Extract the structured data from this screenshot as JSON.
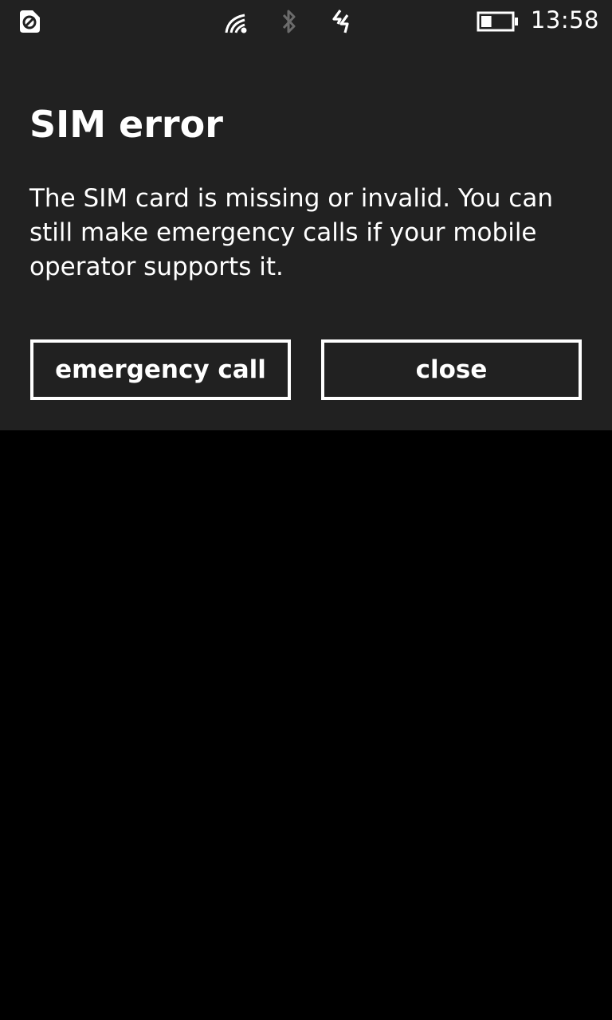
{
  "status_bar": {
    "time": "13:58",
    "icons": [
      "no-sim-icon",
      "wifi-icon",
      "bluetooth-icon",
      "mobile-data-icon",
      "battery-icon"
    ],
    "battery_level": 0.35
  },
  "dialog": {
    "title": "SIM error",
    "message": "The SIM card is missing or invalid. You can still make emergency calls if your mobile operator supports it.",
    "buttons": {
      "emergency_call": "emergency call",
      "close": "close"
    }
  },
  "colors": {
    "dialog_background": "#212121",
    "screen_background": "#000000",
    "text": "#ffffff",
    "dimmed_icon": "#6b6b6b"
  }
}
